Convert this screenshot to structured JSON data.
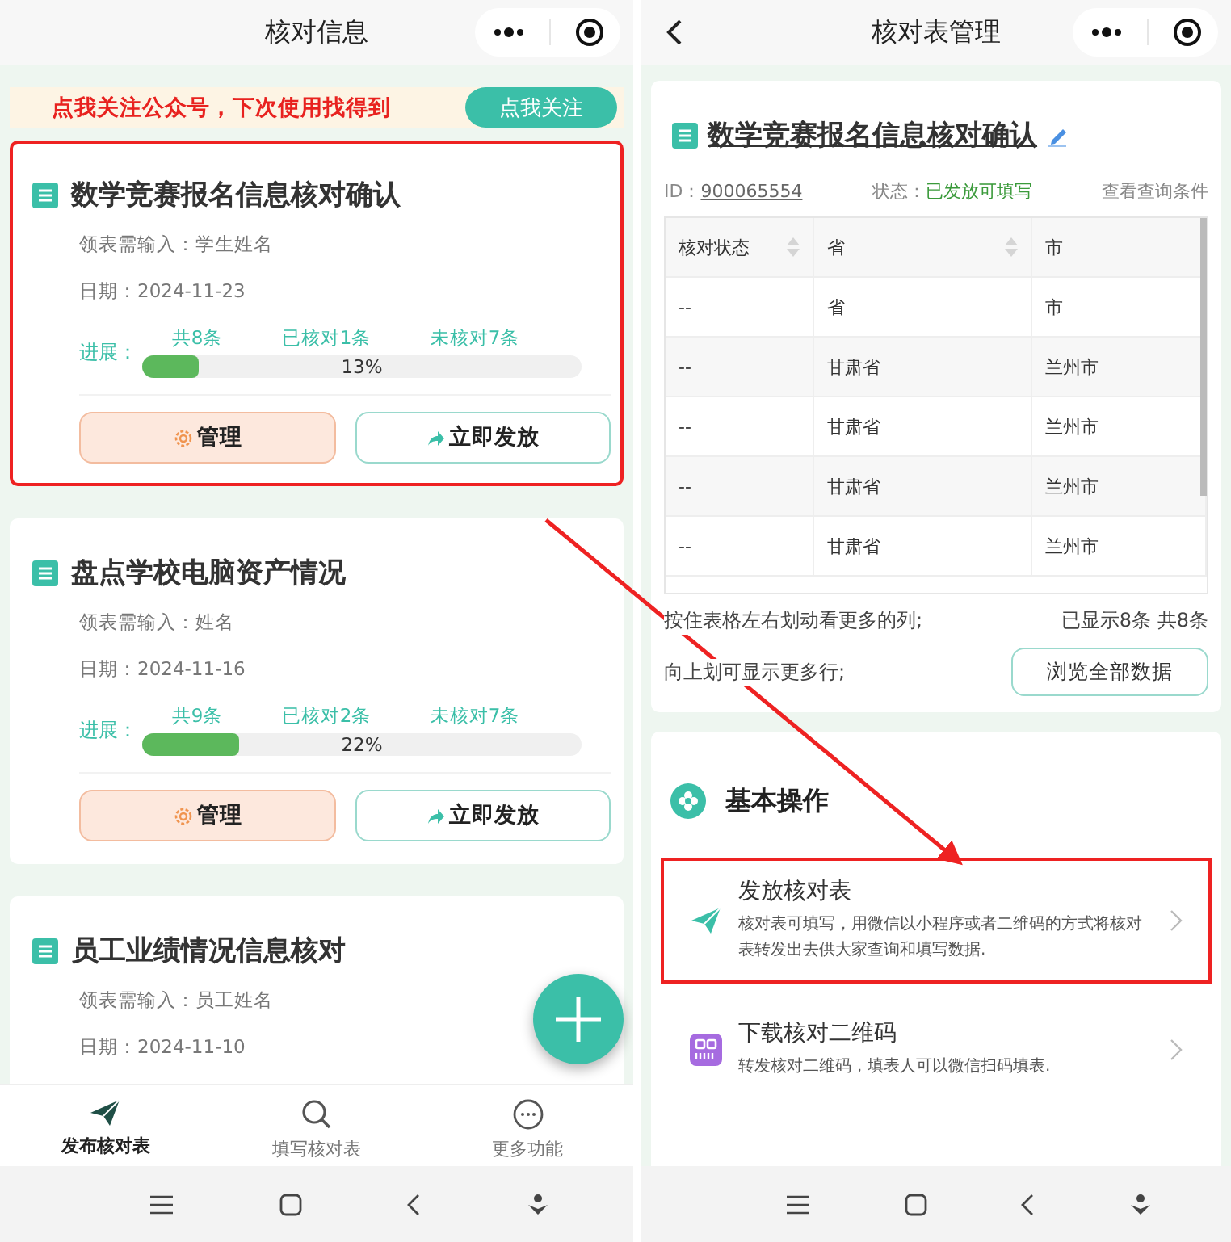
{
  "left_screen": {
    "header": {
      "title": "核对信息"
    },
    "banner": {
      "text": "点我关注公众号，下次使用找得到",
      "button": "点我关注"
    },
    "cards": [
      {
        "title": "数学竞赛报名信息核对确认",
        "input_label": "领表需输入：学生姓名",
        "date": "日期：2024-11-23",
        "progress": {
          "label": "进展：",
          "total": "共8条",
          "checked": "已核对1条",
          "unchecked": "未核对7条",
          "level": 0.13,
          "percent": "13%"
        },
        "buttons": [
          "管理",
          "立即发放"
        ],
        "highlighted": true
      },
      {
        "title": "盘点学校电脑资产情况",
        "input_label": "领表需输入：姓名",
        "date": "日期：2024-11-16",
        "progress": {
          "label": "进展：",
          "total": "共9条",
          "checked": "已核对2条",
          "unchecked": "未核对7条",
          "level": 0.22,
          "percent": "22%"
        },
        "buttons": [
          "管理",
          "立即发放"
        ],
        "highlighted": false
      },
      {
        "title": "员工业绩情况信息核对",
        "input_label": "领表需输入：员工姓名",
        "date": "日期：2024-11-10",
        "highlighted": false
      }
    ],
    "tab_bar": [
      {
        "kind": "send",
        "label": "发布核对表",
        "selected": true
      },
      {
        "kind": "search",
        "label": "填写核对表",
        "selected": false
      },
      {
        "kind": "more",
        "label": "更多功能",
        "selected": false
      }
    ]
  },
  "right_screen": {
    "header": {
      "title": "核对表管理"
    },
    "detail": {
      "title": "数学竞赛报名信息核对确认",
      "id_label": "ID：",
      "id": "900065554",
      "status_label": "状态：",
      "status": "已发放可填写",
      "query_link": "查看查询条件"
    },
    "table": {
      "columns": [
        {
          "label": "核对状态",
          "sortable": true
        },
        {
          "label": "省",
          "sortable": true
        },
        {
          "label": "市",
          "sortable": false
        }
      ],
      "rows": [
        [
          "--",
          "省",
          "市"
        ],
        [
          "--",
          "甘肃省",
          "兰州市"
        ],
        [
          "--",
          "甘肃省",
          "兰州市"
        ],
        [
          "--",
          "甘肃省",
          "兰州市"
        ],
        [
          "--",
          "甘肃省",
          "兰州市"
        ]
      ]
    },
    "hint_columns": "按住表格左右划动看更多的列;",
    "count": "已显示8条 共8条",
    "hint_rows": "向上划可显示更多行;",
    "browse_button": "浏览全部数据",
    "operations": {
      "title": "基本操作",
      "items": [
        {
          "kind": "send",
          "title": "发放核对表",
          "description": "核对表可填写，用微信以小程序或者二维码的方式将核对表转发出去供大家查询和填写数据.",
          "highlighted": true
        },
        {
          "kind": "qr",
          "title": "下载核对二维码",
          "description": "转发核对二维码，填表人可以微信扫码填表.",
          "highlighted": false
        }
      ]
    }
  },
  "annotation_arrow": true
}
